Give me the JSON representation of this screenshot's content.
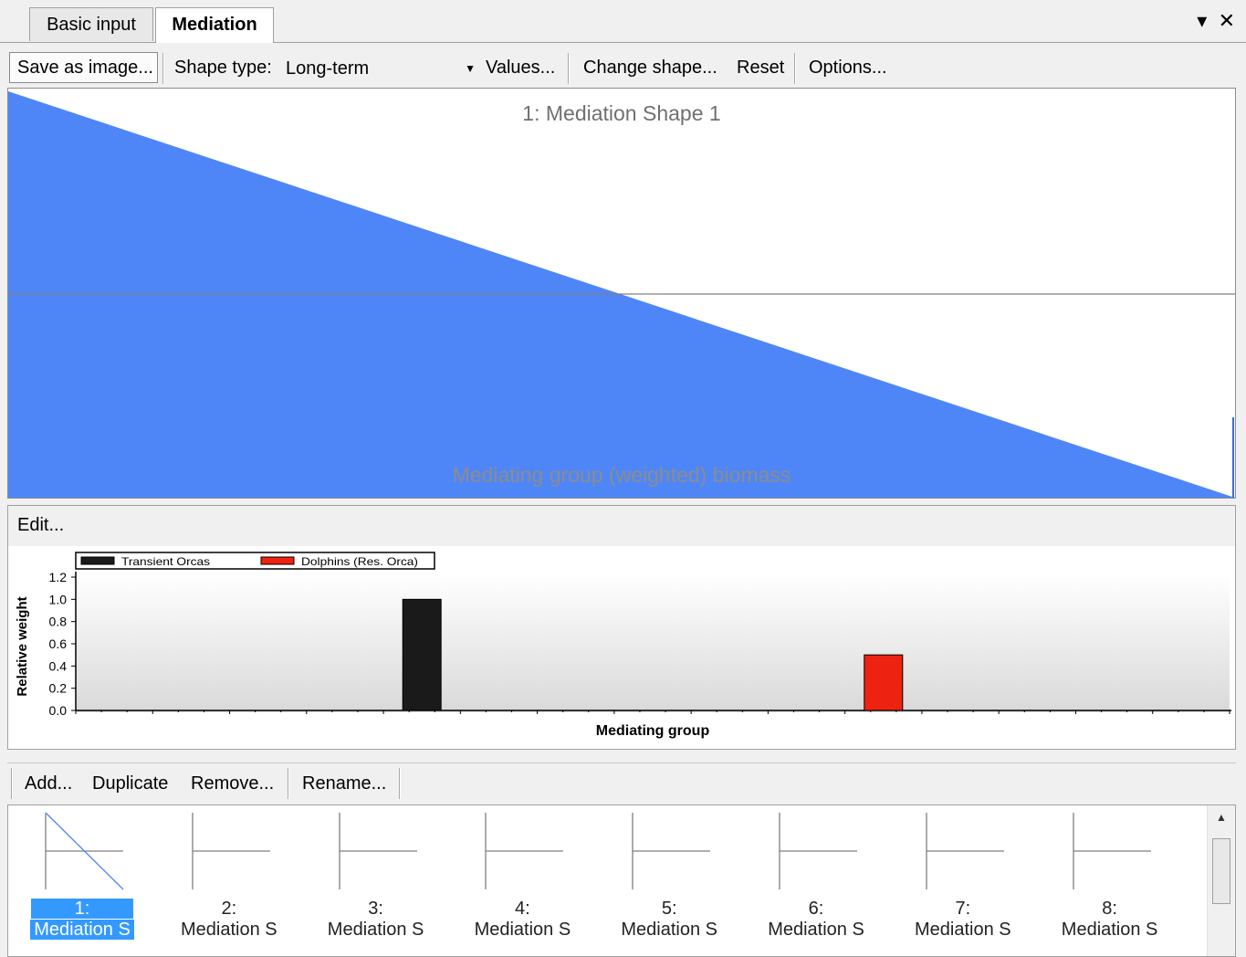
{
  "tabs": [
    {
      "label": "Basic input",
      "active": false
    },
    {
      "label": "Mediation",
      "active": true
    }
  ],
  "window_controls": {
    "dropdown": "▾",
    "close": "✕"
  },
  "toolbar": {
    "save_image": "Save as image...",
    "shape_type_label": "Shape type:",
    "shape_type_value": "Long-term",
    "values": "Values...",
    "change_shape": "Change shape...",
    "reset": "Reset",
    "options": "Options..."
  },
  "shape_plot": {
    "title": "1: Mediation Shape 1",
    "xlabel": "Mediating group (weighted) biomass",
    "fill_color": "#4f86f7"
  },
  "weight_panel": {
    "edit_label": "Edit..."
  },
  "chart_data": {
    "type": "bar",
    "xlabel": "Mediating group",
    "ylabel": "Relative weight",
    "ylim": [
      0,
      1.2
    ],
    "yticks": [
      "0.0",
      "0.2",
      "0.4",
      "0.6",
      "0.8",
      "1.0",
      "1.2"
    ],
    "series": [
      {
        "name": "Transient Orcas",
        "color": "#1a1a1a",
        "slot": 5,
        "value": 1.0
      },
      {
        "name": "Dolphins (Res. Orca)",
        "color": "#ee2211",
        "slot": 11,
        "value": 0.5
      }
    ],
    "slots": 15
  },
  "list_toolbar": {
    "add": "Add...",
    "duplicate": "Duplicate",
    "remove": "Remove...",
    "rename": "Rename..."
  },
  "shapes": [
    {
      "num": "1:",
      "name": "Mediation S",
      "selected": true
    },
    {
      "num": "2:",
      "name": "Mediation S",
      "selected": false
    },
    {
      "num": "3:",
      "name": "Mediation S",
      "selected": false
    },
    {
      "num": "4:",
      "name": "Mediation S",
      "selected": false
    },
    {
      "num": "5:",
      "name": "Mediation S",
      "selected": false
    },
    {
      "num": "6:",
      "name": "Mediation S",
      "selected": false
    },
    {
      "num": "7:",
      "name": "Mediation S",
      "selected": false
    },
    {
      "num": "8:",
      "name": "Mediation S",
      "selected": false
    }
  ]
}
